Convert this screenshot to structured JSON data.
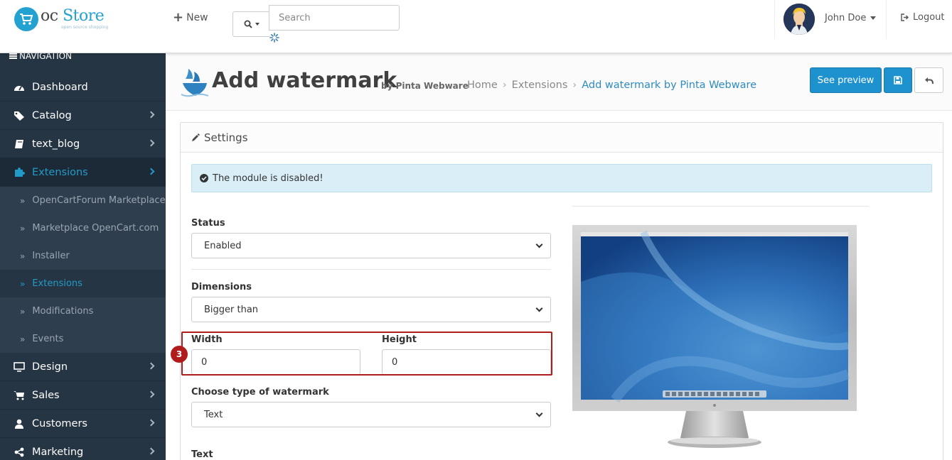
{
  "header": {
    "logo_brand_prefix": "oc",
    "logo_brand_suffix": "Store",
    "logo_tagline": "open source shopping",
    "new_label": "New",
    "search_placeholder": "Search",
    "user_name": "John Doe",
    "logout_label": "Logout"
  },
  "sidebar": {
    "title": "NAVIGATION",
    "items": [
      {
        "label": "Dashboard",
        "icon": "dashboard-icon"
      },
      {
        "label": "Catalog",
        "icon": "tags-icon"
      },
      {
        "label": "text_blog",
        "icon": "book-icon"
      },
      {
        "label": "Extensions",
        "icon": "puzzle-icon"
      },
      {
        "label": "Design",
        "icon": "desktop-icon"
      },
      {
        "label": "Sales",
        "icon": "cart-icon"
      },
      {
        "label": "Customers",
        "icon": "user-icon"
      },
      {
        "label": "Marketing",
        "icon": "share-icon"
      }
    ],
    "subitems": [
      {
        "label": "OpenCartForum Marketplace"
      },
      {
        "label": "Marketplace OpenCart.com"
      },
      {
        "label": "Installer"
      },
      {
        "label": "Extensions"
      },
      {
        "label": "Modifications"
      },
      {
        "label": "Events"
      }
    ],
    "active_item": "Extensions",
    "active_subitem": "Extensions"
  },
  "page": {
    "title": "Add watermark",
    "subtitle": "by Pinta Webware",
    "breadcrumb": [
      "Home",
      "Extensions",
      "Add watermark by Pinta Webware"
    ],
    "preview_button": "See preview"
  },
  "panel": {
    "heading": "Settings",
    "alert_text": "The module is disabled!",
    "status_label": "Status",
    "status_value": "Enabled",
    "dimensions_label": "Dimensions",
    "dimensions_value": "Bigger than",
    "width_label": "Width",
    "width_value": "0",
    "height_label": "Height",
    "height_value": "0",
    "watermark_type_label": "Choose type of watermark",
    "watermark_type_value": "Text",
    "text_label": "Text",
    "step_number": "3"
  },
  "colors": {
    "sidebar_bg": "#263544",
    "accent": "#1e91cf",
    "highlight": "#b01c1c",
    "alert_bg": "#d9eef6"
  }
}
